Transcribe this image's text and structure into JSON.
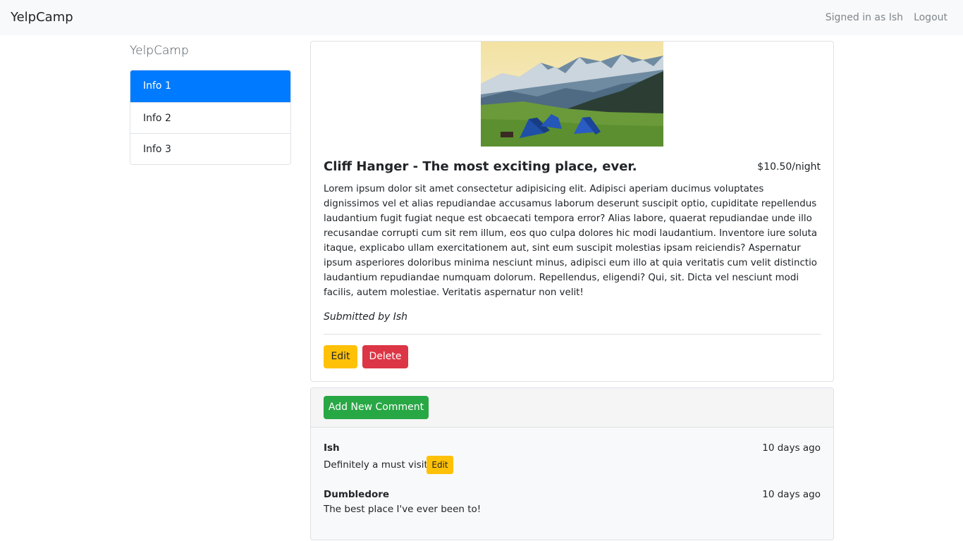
{
  "navbar": {
    "brand": "YelpCamp",
    "signed_in": "Signed in as Ish",
    "logout": "Logout"
  },
  "sidebar": {
    "title": "YelpCamp",
    "items": [
      {
        "label": "Info 1",
        "active": true
      },
      {
        "label": "Info 2",
        "active": false
      },
      {
        "label": "Info 3",
        "active": false
      }
    ]
  },
  "campground": {
    "title": "Cliff Hanger - The most exciting place, ever.",
    "price": "$10.50/night",
    "description": "Lorem ipsum dolor sit amet consectetur adipisicing elit. Adipisci aperiam ducimus voluptates dignissimos vel et alias repudiandae accusamus laborum deserunt suscipit optio, cupiditate repellendus laudantium fugit fugiat neque est obcaecati tempora error? Alias labore, quaerat repudiandae unde illo recusandae corrupti cum sit rem illum, eos quo culpa dolores hic modi laudantium. Inventore iure soluta itaque, explicabo ullam exercitationem aut, sint eum suscipit molestias ipsam reiciendis? Aspernatur ipsum asperiores doloribus minima nesciunt minus, adipisci eum illo at quia veritatis cum velit distinctio laudantium repudiandae numquam dolorum. Repellendus, eligendi? Qui, sit. Dicta vel nesciunt modi facilis, autem molestiae. Veritatis aspernatur non velit!",
    "submitted_by": "Submitted by Ish",
    "edit_label": "Edit",
    "delete_label": "Delete"
  },
  "comments": {
    "add_label": "Add New Comment",
    "items": [
      {
        "author": "Ish",
        "time": "10 days ago",
        "text": "Definitely a must visit.",
        "edit_label": "Edit"
      },
      {
        "author": "Dumbledore",
        "time": "10 days ago",
        "text": "The best place I've ever been to!"
      }
    ]
  },
  "colors": {
    "primary": "#007bff",
    "warning": "#ffc107",
    "danger": "#dc3545",
    "success": "#28a745"
  }
}
